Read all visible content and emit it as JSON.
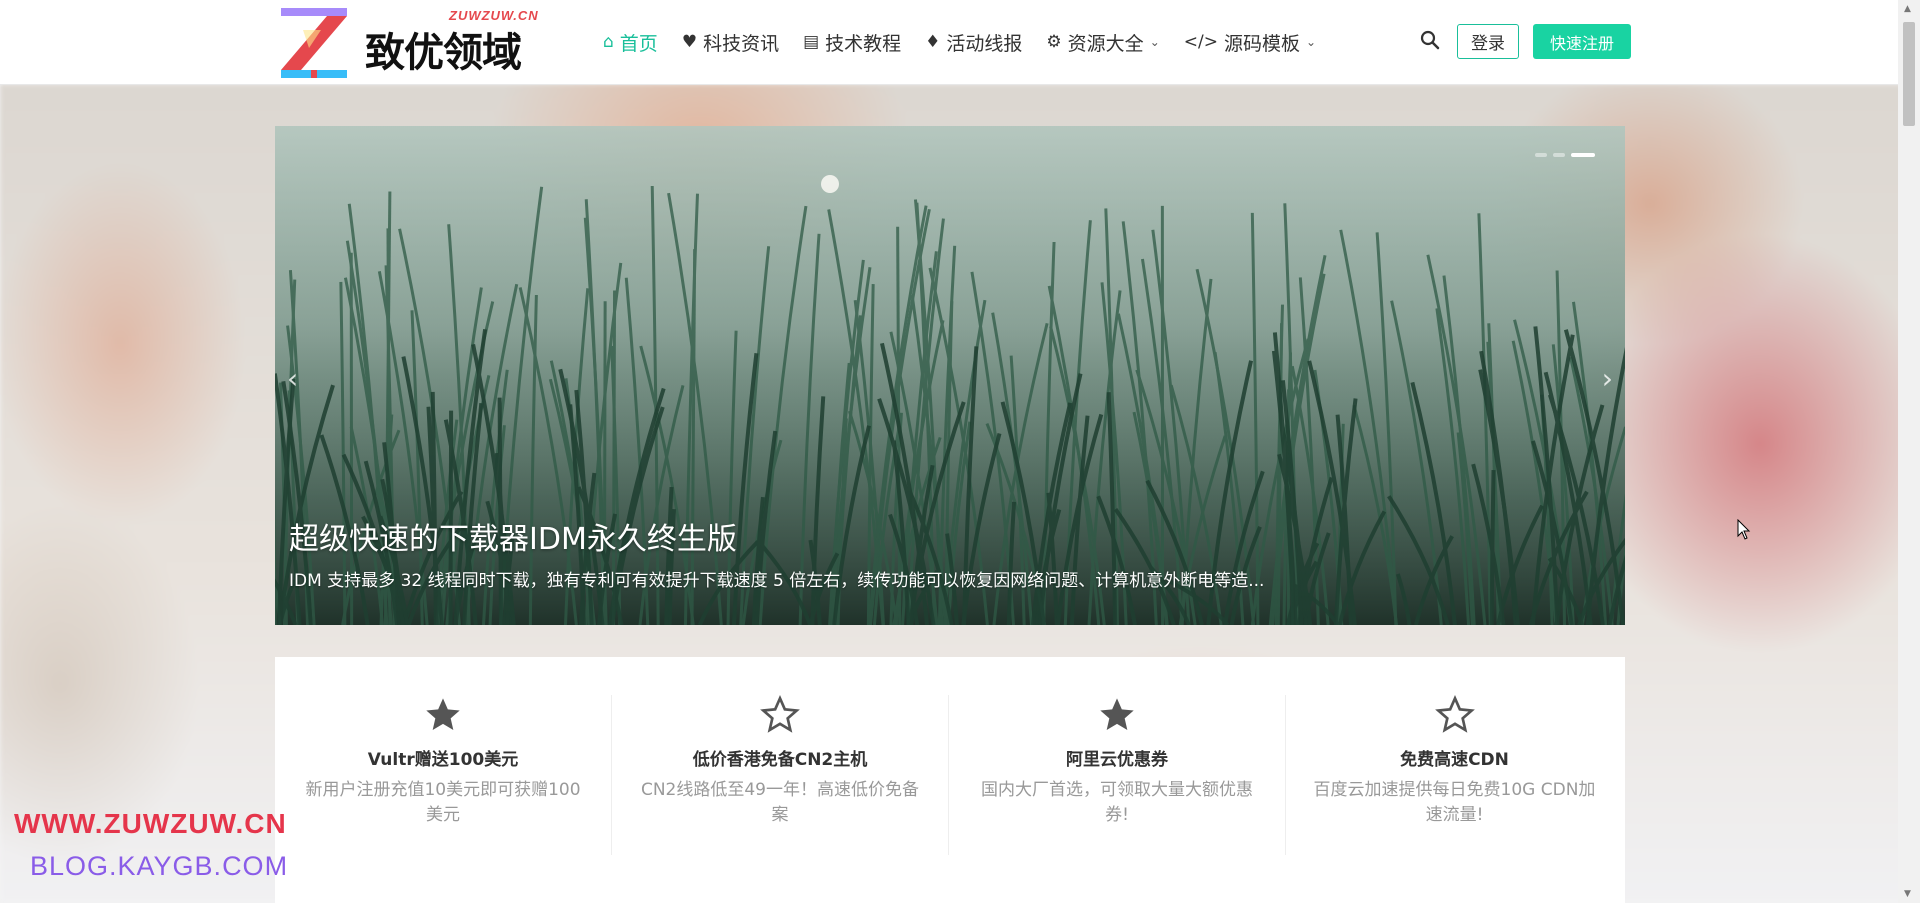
{
  "logo": {
    "domain_text": "ZUWZUW.CN",
    "name": "致优领域"
  },
  "nav": {
    "items": [
      {
        "label": "首页",
        "icon": "home-icon",
        "active": true
      },
      {
        "label": "科技资讯",
        "icon": "heartbeat-icon"
      },
      {
        "label": "技术教程",
        "icon": "book-icon"
      },
      {
        "label": "活动线报",
        "icon": "fire-icon"
      },
      {
        "label": "资源大全",
        "icon": "gears-icon",
        "dropdown": true
      },
      {
        "label": "源码模板",
        "icon": "code-icon",
        "dropdown": true
      }
    ],
    "login": "登录",
    "register": "快速注册"
  },
  "slider": {
    "title": "超级快速的下载器IDM永久终生版",
    "description": "IDM 支持最多 32 线程同时下载，独有专利可有效提升下载速度 5 倍左右，续传功能可以恢复因网络问题、计算机意外断电等造...",
    "active_slide": 3,
    "slide_count": 3
  },
  "features": [
    {
      "title": "Vultr赠送100美元",
      "desc": "新用户注册充值10美元即可获赠100美元",
      "icon": "star-filled-icon"
    },
    {
      "title": "低价香港免备CN2主机",
      "desc": "CN2线路低至49一年！高速低价免备案",
      "icon": "star-outline-icon"
    },
    {
      "title": "阿里云优惠券",
      "desc": "国内大厂首选，可领取大量大额优惠券!",
      "icon": "star-filled-icon"
    },
    {
      "title": "免费高速CDN",
      "desc": "百度云加速提供每日免费10G CDN加速流量!",
      "icon": "star-outline-icon"
    }
  ],
  "watermark": {
    "line1": "WWW.ZUWZUW.CN",
    "line2": "BLOG.KAYGB.COM"
  },
  "colors": {
    "accent": "#19bf9a",
    "register_bg": "#19d3a2",
    "watermark_red": "#e5354b",
    "watermark_purple": "#8a5ce8"
  }
}
